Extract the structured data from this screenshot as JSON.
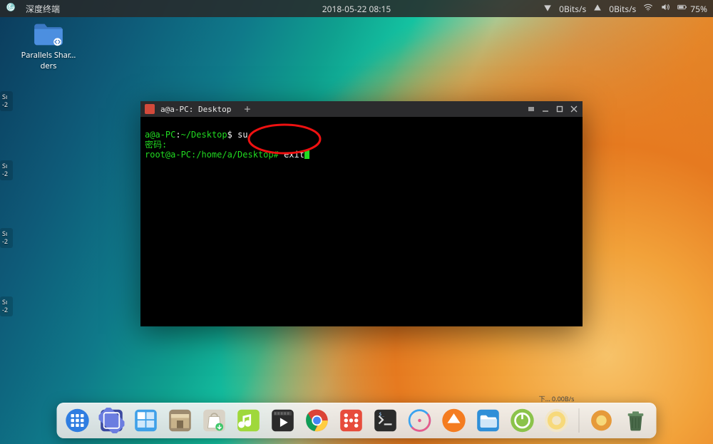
{
  "panel": {
    "app_title": "深度终端",
    "clock": "2018-05-22 08:15",
    "net_down": "0Bits/s",
    "net_up": "0Bits/s",
    "battery": "75%"
  },
  "desktop": {
    "icon1_label": "Parallels Shar…ders",
    "edge_widgets": [
      "Sı\n-2",
      "Sı\n-2",
      "Sı\n-2",
      "Sı\n-2"
    ]
  },
  "terminal": {
    "tab_title": "a@a-PC: Desktop",
    "new_tab_glyph": "+",
    "lines": {
      "l1_prompt": "a@a-PC",
      "l1_sep": ":",
      "l1_path": "~/Desktop",
      "l1_dollar": "$",
      "l1_cmd": "su",
      "l2": "密码:",
      "l3_prompt": "root@a-PC:/home/a/Desktop#",
      "l3_cmd": "exit"
    }
  },
  "dock": {
    "tooltip_shown": "下…   0.00B/s",
    "items": [
      {
        "name": "launcher",
        "icon": "grid"
      },
      {
        "name": "file-manager",
        "icon": "folder-slash"
      },
      {
        "name": "workspaces",
        "icon": "workspaces"
      },
      {
        "name": "app-store",
        "icon": "store"
      },
      {
        "name": "package",
        "icon": "bag"
      },
      {
        "name": "music",
        "icon": "music"
      },
      {
        "name": "player",
        "icon": "play"
      },
      {
        "name": "chrome",
        "icon": "chrome"
      },
      {
        "name": "dice",
        "icon": "dice"
      },
      {
        "name": "terminal",
        "icon": "term"
      },
      {
        "name": "ring",
        "icon": "ring"
      },
      {
        "name": "updater",
        "icon": "up"
      },
      {
        "name": "folder",
        "icon": "folder"
      },
      {
        "name": "power",
        "icon": "power"
      },
      {
        "name": "system",
        "icon": "gear"
      }
    ],
    "trash": {
      "name": "trash"
    }
  }
}
